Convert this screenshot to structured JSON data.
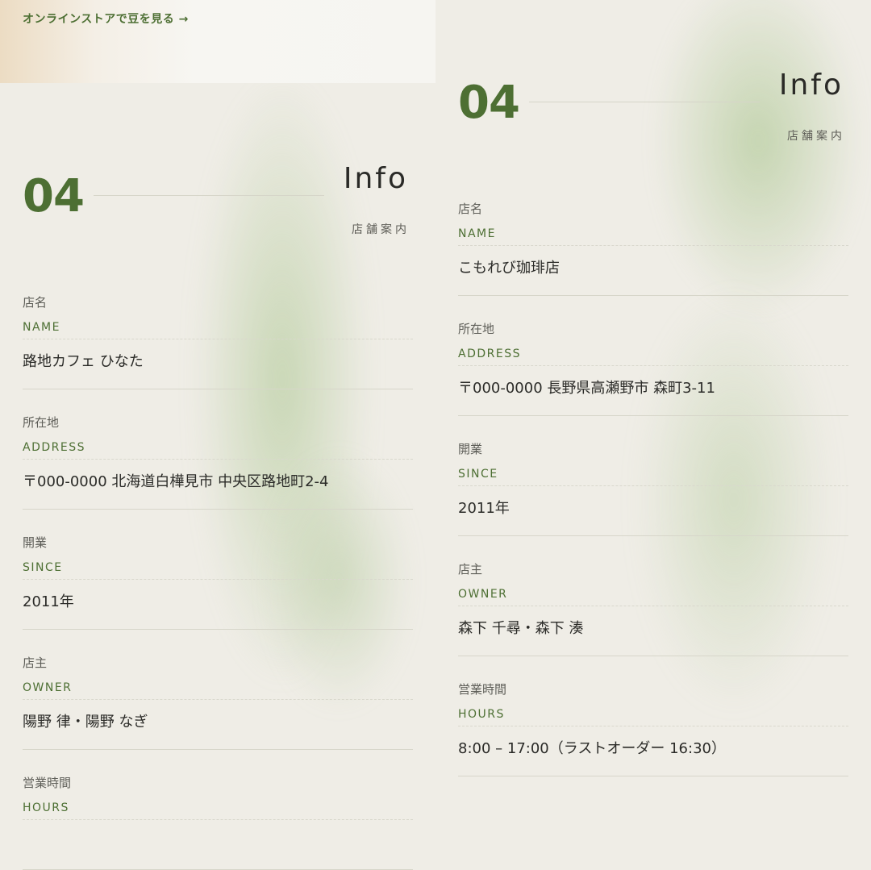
{
  "top_card": {
    "store_link": "オンラインストアで豆を見る →"
  },
  "panels": [
    {
      "section": {
        "number": "04",
        "title": "Info",
        "subtitle": "店舗案内"
      },
      "rows": [
        {
          "label_ja": "店名",
          "label_en": "NAME",
          "value": "路地カフェ ひなた"
        },
        {
          "label_ja": "所在地",
          "label_en": "ADDRESS",
          "value": "〒000-0000 北海道白樺見市 中央区路地町2-4"
        },
        {
          "label_ja": "開業",
          "label_en": "SINCE",
          "value": "2011年"
        },
        {
          "label_ja": "店主",
          "label_en": "OWNER",
          "value": "陽野 律・陽野 なぎ"
        },
        {
          "label_ja": "営業時間",
          "label_en": "HOURS",
          "value": ""
        }
      ]
    },
    {
      "section": {
        "number": "04",
        "title": "Info",
        "subtitle": "店舗案内"
      },
      "rows": [
        {
          "label_ja": "店名",
          "label_en": "NAME",
          "value": "こもれび珈琲店"
        },
        {
          "label_ja": "所在地",
          "label_en": "ADDRESS",
          "value": "〒000-0000 長野県高瀬野市 森町3-11"
        },
        {
          "label_ja": "開業",
          "label_en": "SINCE",
          "value": "2011年"
        },
        {
          "label_ja": "店主",
          "label_en": "OWNER",
          "value": "森下 千尋・森下 湊"
        },
        {
          "label_ja": "営業時間",
          "label_en": "HOURS",
          "value": "8:00 – 17:00（ラストオーダー 16:30）"
        }
      ]
    }
  ],
  "colors": {
    "accent_green": "#4d6f33",
    "background": "#efede6"
  }
}
